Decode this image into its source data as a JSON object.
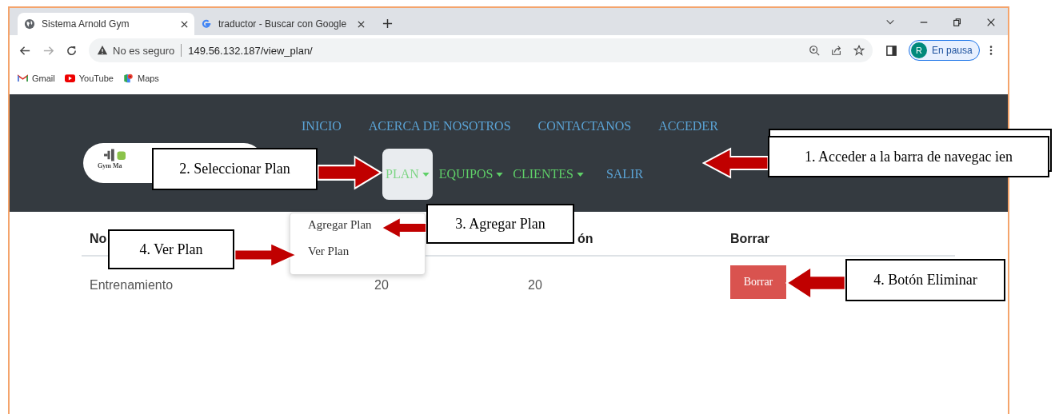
{
  "browser": {
    "tabs": [
      {
        "title": "Sistema Arnold Gym",
        "selected": true,
        "kind": "globe"
      },
      {
        "title": "traductor - Buscar con Google",
        "selected": false,
        "kind": "google"
      }
    ],
    "address": {
      "security": "No es seguro",
      "url": "149.56.132.187/view_plan/"
    },
    "bookmarks": [
      {
        "label": "Gmail",
        "kind": "gmail"
      },
      {
        "label": "YouTube",
        "kind": "youtube"
      },
      {
        "label": "Maps",
        "kind": "maps"
      }
    ],
    "profile": {
      "initial": "R",
      "status": "En pausa"
    }
  },
  "page": {
    "nav_top": [
      "INICIO",
      "ACERCA DE NOSOTROS",
      "CONTACTANOS",
      "ACCEDER"
    ],
    "logo_text": "Gym Ma",
    "nav_bottom": [
      {
        "label": "PLAN",
        "dropdown": true,
        "selected": true
      },
      {
        "label": "EQUIPOS",
        "dropdown": true,
        "selected": false
      },
      {
        "label": "CLIENTES",
        "dropdown": true,
        "selected": false
      },
      {
        "label": "SALIR",
        "dropdown": false,
        "selected": false
      }
    ],
    "menu": [
      "Agregar Plan",
      "Ver Plan"
    ],
    "table": {
      "columns": [
        "No",
        "",
        "ón",
        "Borrar"
      ],
      "rows": [
        {
          "cells": [
            "Entrenamiento",
            "20",
            "20"
          ],
          "button": "Borrar"
        }
      ]
    }
  },
  "annotations": [
    {
      "text": "1. Acceder a la barra de navegac ien"
    },
    {
      "text": "2. Seleccionar Plan"
    },
    {
      "text": "3. Agregar Plan"
    },
    {
      "text": "4. Ver Plan"
    },
    {
      "text": "4. Botón Eliminar"
    }
  ]
}
